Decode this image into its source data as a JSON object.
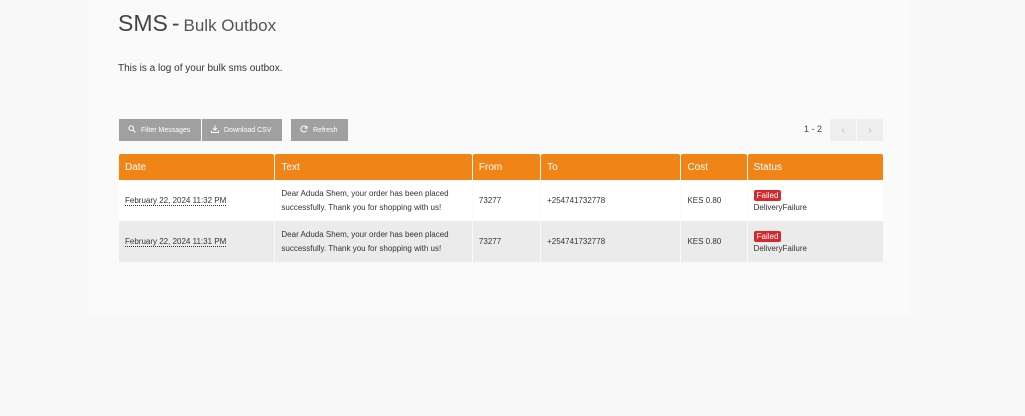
{
  "header": {
    "title": "SMS",
    "separator": "-",
    "subtitle": "Bulk Outbox"
  },
  "intro": "This is a log of your bulk sms outbox.",
  "toolbar": {
    "filter_label": "Filter Messages",
    "download_label": "Download CSV",
    "refresh_label": "Refresh"
  },
  "pager": {
    "count": "1 - 2",
    "prev": "‹",
    "next": "›"
  },
  "table": {
    "columns": [
      "Date",
      "Text",
      "From",
      "To",
      "Cost",
      "Status"
    ],
    "rows": [
      {
        "date": "February 22, 2024 11:32 PM",
        "text": "Dear Aduda Shem, your order has been placed successfully. Thank you for shopping with us!",
        "from": "73277",
        "to": "+254741732778",
        "cost": "KES 0.80",
        "status": "Failed",
        "status_reason": "DeliveryFailure"
      },
      {
        "date": "February 22, 2024 11:31 PM",
        "text": "Dear Aduda Shem, your order has been placed successfully. Thank you for shopping with us!",
        "from": "73277",
        "to": "+254741732778",
        "cost": "KES 0.80",
        "status": "Failed",
        "status_reason": "DeliveryFailure"
      }
    ]
  },
  "colors": {
    "header_accent": "#f18416",
    "status_failed": "#d9262c",
    "button_gray": "#a0a0a0"
  },
  "icons": {
    "filter": "search-icon",
    "download": "download-icon",
    "refresh": "refresh-icon"
  }
}
